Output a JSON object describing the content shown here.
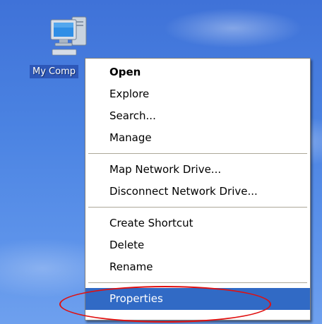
{
  "desktop": {
    "icon": {
      "label": "My Comp",
      "icon_name": "computer-icon"
    }
  },
  "context_menu": {
    "groups": [
      [
        {
          "label": "Open",
          "bold": true
        },
        {
          "label": "Explore"
        },
        {
          "label": "Search..."
        },
        {
          "label": "Manage"
        }
      ],
      [
        {
          "label": "Map Network Drive..."
        },
        {
          "label": "Disconnect Network Drive..."
        }
      ],
      [
        {
          "label": "Create Shortcut"
        },
        {
          "label": "Delete"
        },
        {
          "label": "Rename"
        }
      ],
      [
        {
          "label": "Properties",
          "selected": true
        }
      ]
    ]
  },
  "highlight": {
    "color": "#e01010",
    "target": "Properties"
  },
  "colors": {
    "selection": "#316ac5",
    "desktop_blue": "#4b83e2"
  }
}
